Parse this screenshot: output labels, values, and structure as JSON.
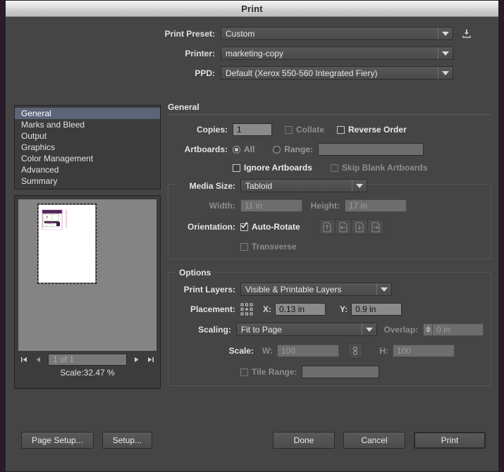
{
  "window": {
    "title": "Print"
  },
  "preset": {
    "print_preset_label": "Print Preset:",
    "print_preset_value": "Custom",
    "printer_label": "Printer:",
    "printer_value": "marketing-copy",
    "ppd_label": "PPD:",
    "ppd_value": "Default (Xerox 550-560 Integrated Fiery)",
    "save_preset_icon": "save-preset-icon"
  },
  "sidebar": {
    "items": [
      {
        "label": "General",
        "selected": true
      },
      {
        "label": "Marks and Bleed",
        "selected": false
      },
      {
        "label": "Output",
        "selected": false
      },
      {
        "label": "Graphics",
        "selected": false
      },
      {
        "label": "Color Management",
        "selected": false
      },
      {
        "label": "Advanced",
        "selected": false
      },
      {
        "label": "Summary",
        "selected": false
      }
    ]
  },
  "preview": {
    "page_field_value": "1 of 1",
    "scale_label": "Scale:32.47 %",
    "first_icon": "first-page-icon",
    "prev_icon": "previous-page-icon",
    "next_icon": "next-page-icon",
    "last_icon": "last-page-icon"
  },
  "general": {
    "section_title": "General",
    "copies_label": "Copies:",
    "copies_value": "1",
    "collate_label": "Collate",
    "collate_checked": false,
    "reverse_order_label": "Reverse Order",
    "reverse_order_checked": false,
    "artboards_label": "Artboards:",
    "all_label": "All",
    "all_selected": true,
    "range_label": "Range:",
    "range_value": "",
    "ignore_artboards_label": "Ignore Artboards",
    "ignore_artboards_checked": false,
    "skip_blank_label": "Skip Blank Artboards",
    "skip_blank_checked": false
  },
  "media": {
    "media_size_label": "Media Size:",
    "media_size_value": "Tabloid",
    "width_label": "Width:",
    "width_value": "11 in",
    "height_label": "Height:",
    "height_value": "17 in",
    "orientation_label": "Orientation:",
    "auto_rotate_label": "Auto-Rotate",
    "auto_rotate_checked": true,
    "transverse_label": "Transverse",
    "transverse_checked": false,
    "orientation_buttons": [
      "portrait-icon",
      "landscape-icon",
      "reverse-portrait-icon",
      "reverse-landscape-icon"
    ]
  },
  "options": {
    "group_title": "Options",
    "print_layers_label": "Print Layers:",
    "print_layers_value": "Visible & Printable Layers",
    "placement_label": "Placement:",
    "placement_proxy_icon": "placement-proxy-icon",
    "x_label": "X:",
    "x_value": "0.13 in",
    "y_label": "Y:",
    "y_value": "0.9 in",
    "scaling_label": "Scaling:",
    "scaling_value": "Fit to Page",
    "overlap_label": "Overlap:",
    "overlap_value": "0 in",
    "scale_label": "Scale:",
    "w_label": "W:",
    "w_value": "100",
    "h_label": "H:",
    "h_value": "100",
    "link_icon": "link-constrain-icon",
    "tile_range_label": "Tile Range:",
    "tile_range_checked": false,
    "tile_range_value": ""
  },
  "footer": {
    "page_setup_label": "Page Setup...",
    "setup_label": "Setup...",
    "done_label": "Done",
    "cancel_label": "Cancel",
    "print_label": "Print"
  },
  "colors": {
    "dialog_bg": "#454545",
    "selection": "#5c6577",
    "field_bg": "#8a8a8a",
    "canvas_bg": "#848484"
  }
}
